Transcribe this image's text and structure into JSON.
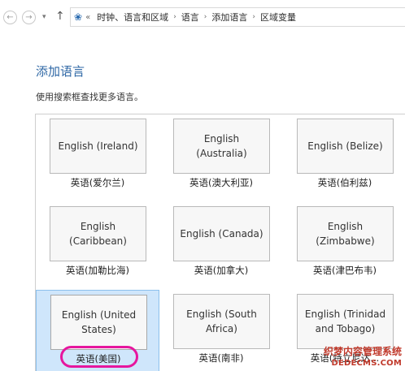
{
  "nav": {
    "back_icon": "arrow-left-icon",
    "forward_icon": "arrow-right-icon",
    "up_icon": "arrow-up-icon",
    "breadcrumb": [
      "时钟、语言和区域",
      "语言",
      "添加语言",
      "区域变量"
    ]
  },
  "page": {
    "title": "添加语言",
    "hint": "使用搜索框查找更多语言。"
  },
  "languages": [
    {
      "tile": "English (Ireland)",
      "label": "英语(爱尔兰)"
    },
    {
      "tile": "English (Australia)",
      "label": "英语(澳大利亚)"
    },
    {
      "tile": "English (Belize)",
      "label": "英语(伯利兹)"
    },
    {
      "tile": "English (Caribbean)",
      "label": "英语(加勒比海)"
    },
    {
      "tile": "English (Canada)",
      "label": "英语(加拿大)"
    },
    {
      "tile": "English (Zimbabwe)",
      "label": "英语(津巴布韦)"
    },
    {
      "tile": "English (United States)",
      "label": "英语(美国)",
      "selected": true
    },
    {
      "tile": "English (South Africa)",
      "label": "英语(南非)"
    },
    {
      "tile": "English (Trinidad and Tobago)",
      "label": "英语(特立尼达..."
    }
  ],
  "watermark": {
    "line1": "织梦内容管理系统",
    "line2": "DEDECMS.COM"
  },
  "colors": {
    "title": "#2e67a5",
    "selected_bg": "#cfe6fb",
    "highlight_ring": "#e6169e"
  }
}
